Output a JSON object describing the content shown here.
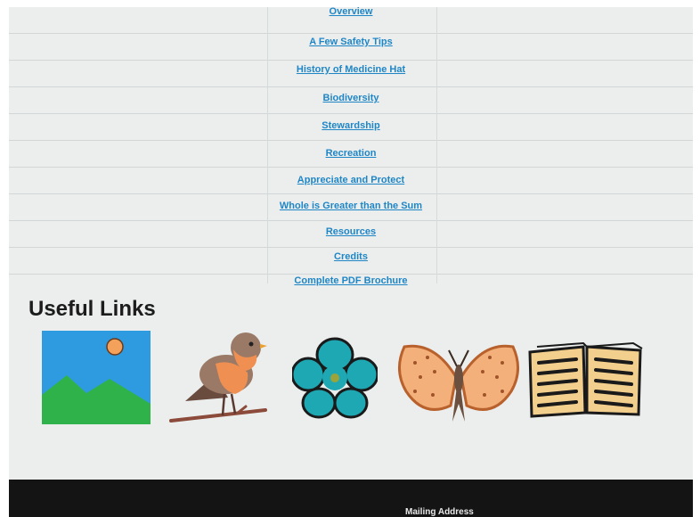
{
  "toc": {
    "items": [
      {
        "label": "Overview"
      },
      {
        "label": "A Few Safety Tips"
      },
      {
        "label": "History of Medicine Hat"
      },
      {
        "label": "Biodiversity"
      },
      {
        "label": "Stewardship"
      },
      {
        "label": "Recreation"
      },
      {
        "label": "Appreciate and Protect"
      },
      {
        "label": "Whole is Greater than the Sum"
      },
      {
        "label": "Resources"
      },
      {
        "label": "Credits"
      },
      {
        "label": "Complete PDF Brochure"
      }
    ]
  },
  "useful_links": {
    "heading": "Useful Links",
    "icons": [
      "landscape-image-icon",
      "robin-bird-icon",
      "flower-icon",
      "butterfly-icon",
      "open-book-icon"
    ]
  },
  "footer": {
    "mailing_label": "Mailing Address"
  },
  "colors": {
    "link": "#1f86c6",
    "footer_bg": "#141414"
  }
}
